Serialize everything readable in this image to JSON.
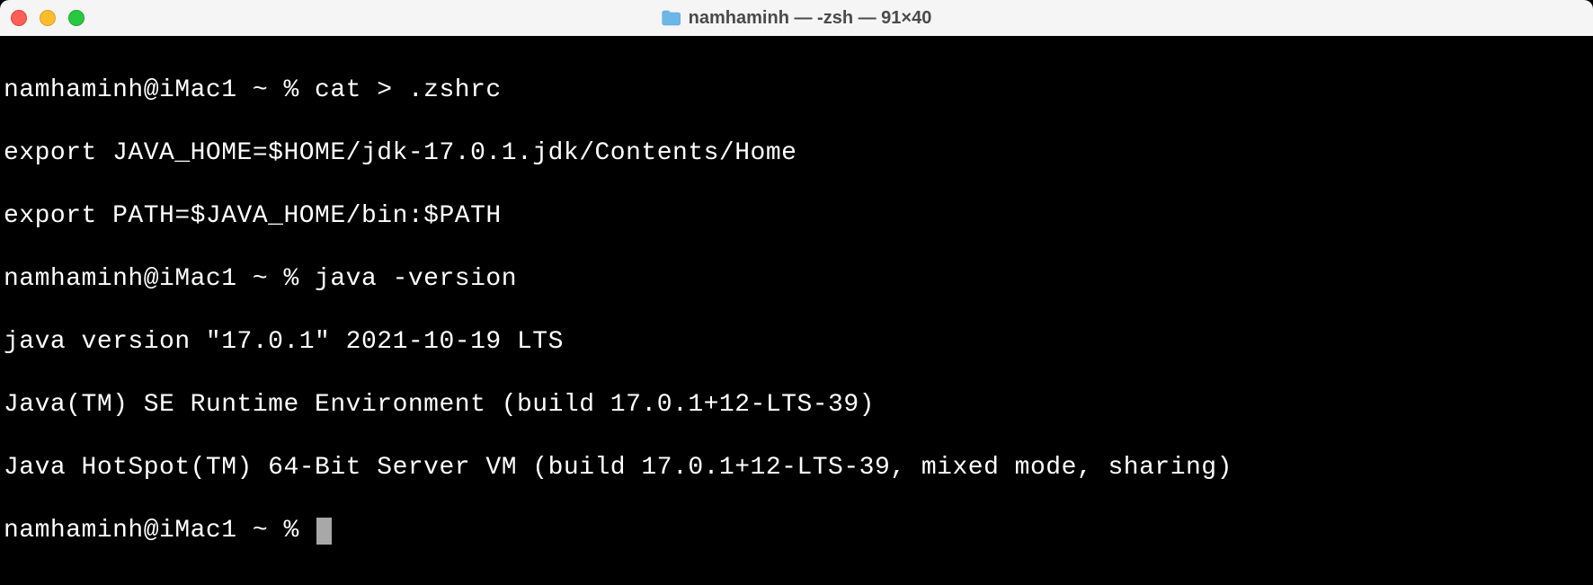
{
  "titlebar": {
    "title": "namhaminh — -zsh — 91×40",
    "folder_icon_name": "folder-icon"
  },
  "terminal": {
    "lines": [
      "namhaminh@iMac1 ~ % cat > .zshrc",
      "export JAVA_HOME=$HOME/jdk-17.0.1.jdk/Contents/Home",
      "export PATH=$JAVA_HOME/bin:$PATH",
      "namhaminh@iMac1 ~ % java -version",
      "java version \"17.0.1\" 2021-10-19 LTS",
      "Java(TM) SE Runtime Environment (build 17.0.1+12-LTS-39)",
      "Java HotSpot(TM) 64-Bit Server VM (build 17.0.1+12-LTS-39, mixed mode, sharing)",
      "namhaminh@iMac1 ~ % "
    ]
  }
}
